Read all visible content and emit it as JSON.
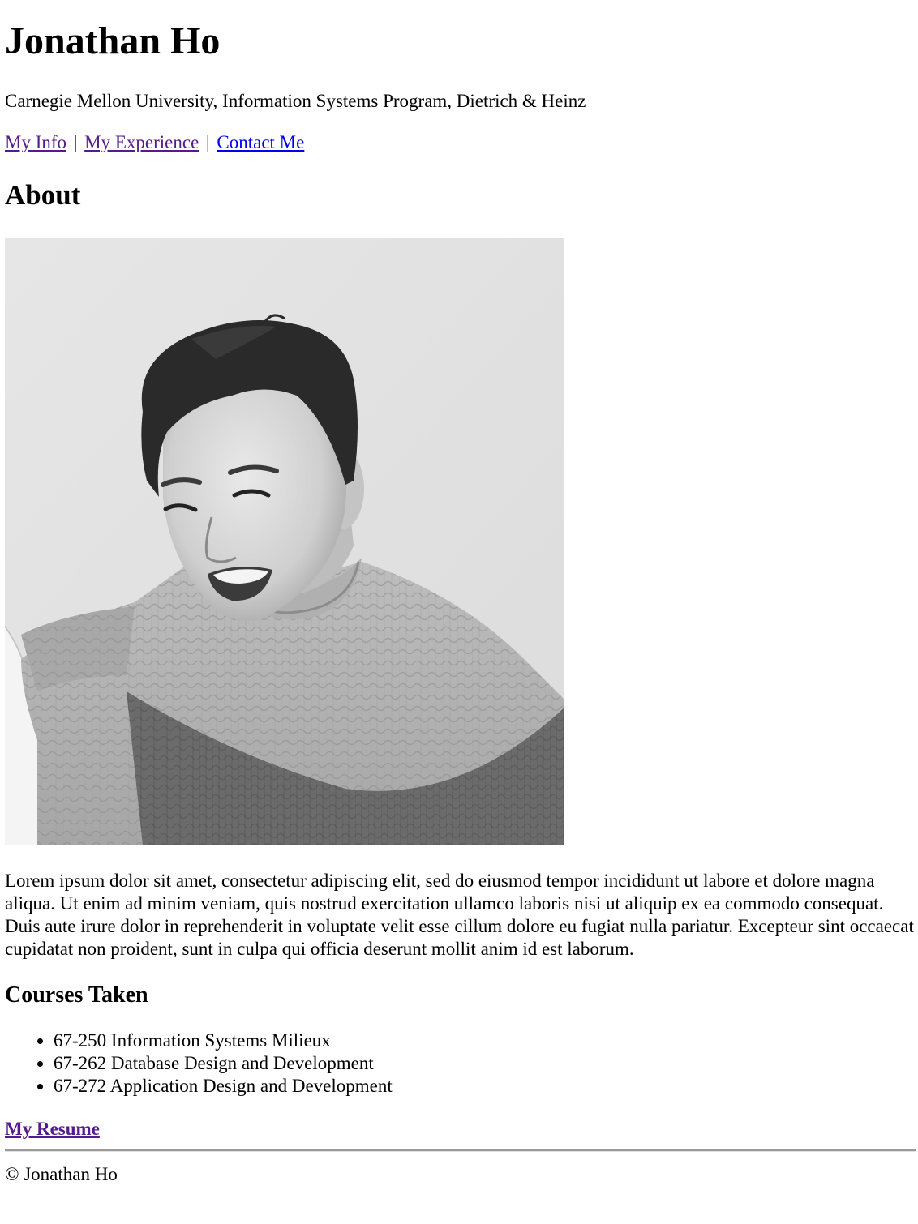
{
  "header": {
    "name": "Jonathan Ho",
    "affiliation": "Carnegie Mellon University, Information Systems Program, Dietrich & Heinz"
  },
  "nav": {
    "items": [
      {
        "label": "My Info"
      },
      {
        "label": "My Experience"
      },
      {
        "label": "Contact Me"
      }
    ],
    "separator": "|"
  },
  "about": {
    "heading": "About",
    "photo_icon": "portrait-photo",
    "bio": "Lorem ipsum dolor sit amet, consectetur adipiscing elit, sed do eiusmod tempor incididunt ut labore et dolore magna aliqua. Ut enim ad minim veniam, quis nostrud exercitation ullamco laboris nisi ut aliquip ex ea commodo consequat. Duis aute irure dolor in reprehenderit in voluptate velit esse cillum dolore eu fugiat nulla pariatur. Excepteur sint occaecat cupidatat non proident, sunt in culpa qui officia deserunt mollit anim id est laborum."
  },
  "courses": {
    "heading": "Courses Taken",
    "items": [
      "67-250 Information Systems Milieux",
      "67-262 Database Design and Development",
      "67-272 Application Design and Development"
    ]
  },
  "resume": {
    "label": "My Resume"
  },
  "footer": {
    "copyright": "© Jonathan Ho"
  },
  "colors": {
    "visited_link": "#551a8b",
    "unvisited_link": "#0000ee"
  }
}
